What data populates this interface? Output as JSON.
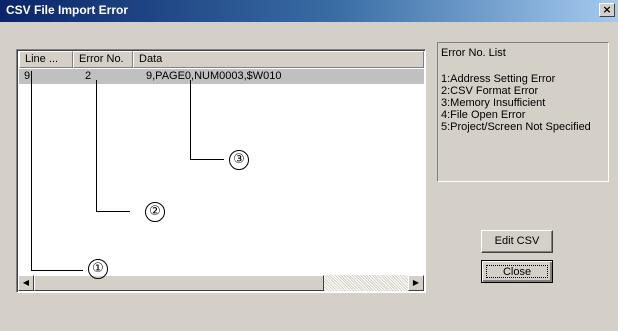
{
  "window": {
    "title": "CSV File Import Error",
    "close_glyph": "×"
  },
  "list": {
    "columns": [
      "Line ...",
      "Error No.",
      "Data"
    ],
    "rows": [
      {
        "line": "9",
        "error_no": "2",
        "data": "9,PAGE0,NUM0003,$W010"
      }
    ]
  },
  "error_list": {
    "title": "Error No. List",
    "items": [
      "1:Address Setting Error",
      "2:CSV Format Error",
      "3:Memory Insufficient",
      "4:File Open Error",
      "5:Project/Screen Not Specified"
    ]
  },
  "buttons": {
    "edit_csv": "Edit CSV",
    "close": "Close"
  },
  "callouts": {
    "c1": "①",
    "c2": "②",
    "c3": "③"
  },
  "icons": {
    "close": "close-icon",
    "scroll_left": "arrow-left-icon",
    "scroll_right": "arrow-right-icon"
  },
  "colors": {
    "title_start": "#0a246a",
    "title_end": "#a6caf0",
    "face": "#d4d0c8"
  }
}
